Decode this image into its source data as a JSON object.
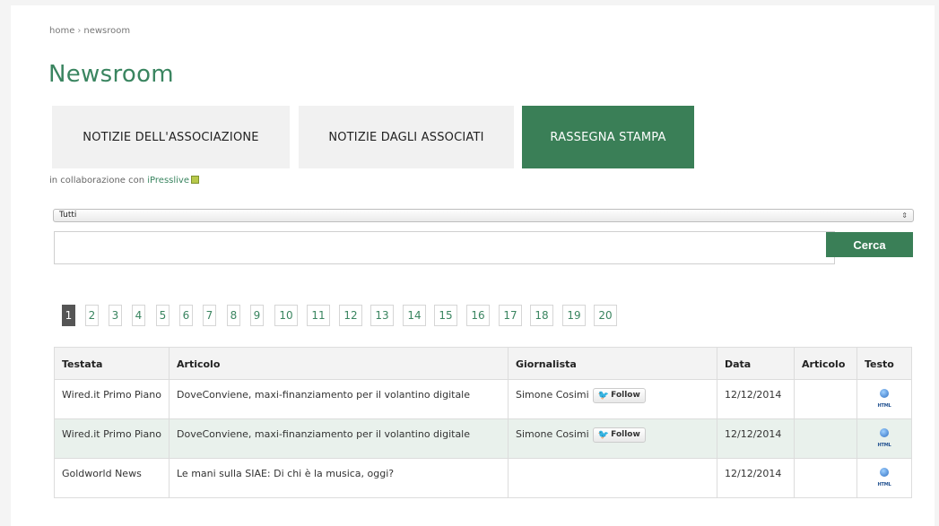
{
  "breadcrumb": {
    "home": "home",
    "separator": "›",
    "current": "newsroom"
  },
  "page_title": "Newsroom",
  "tabs": [
    {
      "label": "NOTIZIE DELL'ASSOCIAZIONE",
      "active": false
    },
    {
      "label": "NOTIZIE DAGLI ASSOCIATI",
      "active": false
    },
    {
      "label": "RASSEGNA STAMPA",
      "active": true
    }
  ],
  "collaboration": {
    "text": "in collaborazione con",
    "link": "iPresslive",
    "icon": "external-link-icon"
  },
  "filter": {
    "selected": "Tutti",
    "arrow": "⇕"
  },
  "search": {
    "value": "",
    "placeholder": "",
    "button_label": "Cerca"
  },
  "pagination": {
    "current": "1",
    "pages": [
      "1",
      "2",
      "3",
      "4",
      "5",
      "6",
      "7",
      "8",
      "9",
      "10",
      "11",
      "12",
      "13",
      "14",
      "15",
      "16",
      "17",
      "18",
      "19",
      "20"
    ]
  },
  "table": {
    "headers": [
      "Testata",
      "Articolo",
      "Giornalista",
      "Data",
      "Articolo",
      "Testo"
    ],
    "follow_label": "Follow",
    "html_icon_label": "HTML",
    "rows": [
      {
        "testata": "Wired.it Primo Piano",
        "articolo": "DoveConviene, maxi-finanziamento per il volantino digitale",
        "giornalista": "Simone Cosimi",
        "follow": true,
        "data": "12/12/2014",
        "articolo2": ""
      },
      {
        "testata": "Wired.it Primo Piano",
        "articolo": "DoveConviene, maxi-finanziamento per il volantino digitale",
        "giornalista": "Simone Cosimi",
        "follow": true,
        "data": "12/12/2014",
        "articolo2": ""
      },
      {
        "testata": "Goldworld News",
        "articolo": "Le mani sulla SIAE: Di chi è la musica, oggi?",
        "giornalista": "",
        "follow": false,
        "data": "12/12/2014",
        "articolo2": ""
      }
    ]
  },
  "colors": {
    "accent": "#3a7f57",
    "title": "#3a8560",
    "row_alt": "#e9f1ec"
  }
}
